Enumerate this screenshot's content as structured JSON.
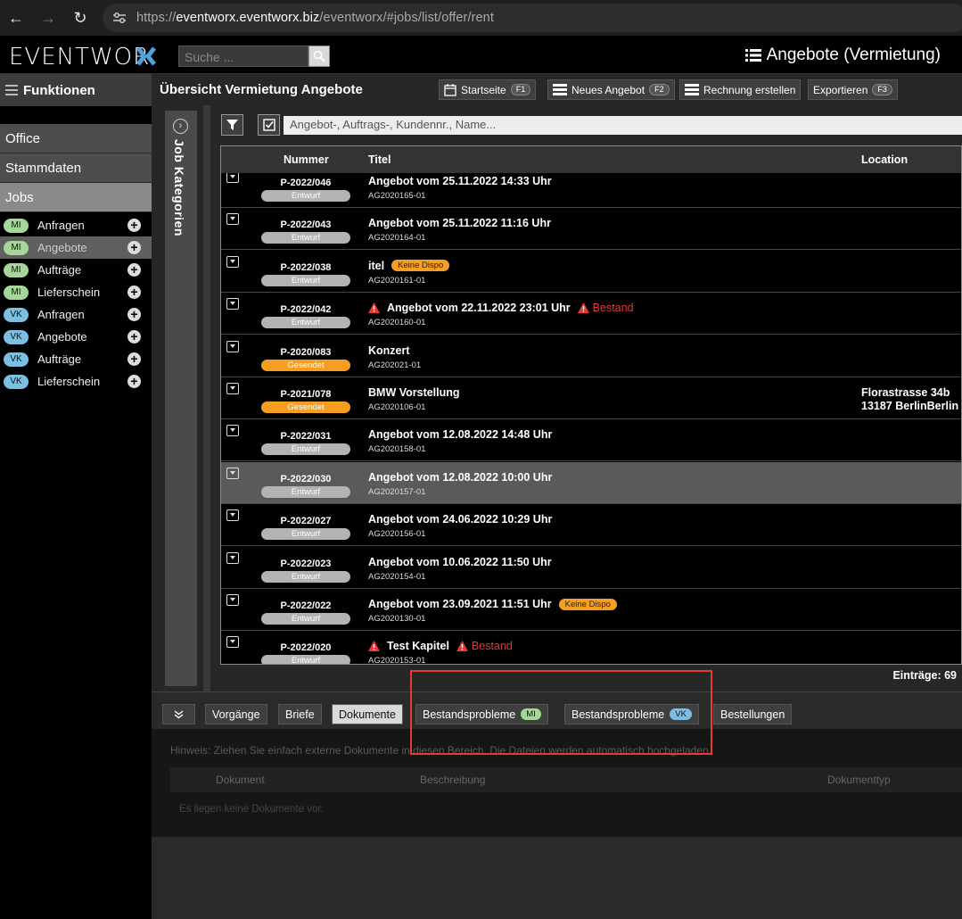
{
  "browser": {
    "url_prefix": "https://",
    "url_host": "eventworx.eventworx.biz",
    "url_path": "/eventworx/#jobs/list/offer/rent"
  },
  "app": {
    "logo": "EVENTWOR",
    "search_placeholder": "Suche ...",
    "page_title": "Angebote (Vermietung)"
  },
  "sidebar": {
    "functions_label": "Funktionen",
    "sections": [
      "Office",
      "Stammdaten",
      "Jobs"
    ],
    "items": [
      {
        "badge": "MI",
        "label": "Anfragen"
      },
      {
        "badge": "MI",
        "label": "Angebote"
      },
      {
        "badge": "MI",
        "label": "Aufträge"
      },
      {
        "badge": "MI",
        "label": "Lieferschein"
      },
      {
        "badge": "VK",
        "label": "Anfragen"
      },
      {
        "badge": "VK",
        "label": "Angebote"
      },
      {
        "badge": "VK",
        "label": "Aufträge"
      },
      {
        "badge": "VK",
        "label": "Lieferschein"
      }
    ]
  },
  "main": {
    "title": "Übersicht Vermietung Angebote",
    "toolbar": [
      {
        "label": "Startseite",
        "key": "F1"
      },
      {
        "label": "Neues Angebot",
        "key": "F2"
      },
      {
        "label": "Rechnung erstellen",
        "key": ""
      },
      {
        "label": "Exportieren",
        "key": "F3"
      }
    ],
    "side_panel_label": "Job Kategorien",
    "filter_placeholder": "Angebot-, Auftrags-, Kundennr., Name...",
    "columns": {
      "nummer": "Nummer",
      "titel": "Titel",
      "location": "Location"
    },
    "rows": [
      {
        "nr": "P-2022/046",
        "status": "Entwurf",
        "title": "Angebot vom 25.11.2022 14:33 Uhr",
        "sub": "AG2020165-01"
      },
      {
        "nr": "P-2022/043",
        "status": "Entwurf",
        "title": "Angebot vom 25.11.2022 11:16 Uhr",
        "sub": "AG2020164-01"
      },
      {
        "nr": "P-2022/038",
        "status": "Entwurf",
        "title": "itel",
        "sub": "AG2020161-01",
        "chip": "Keine Dispo"
      },
      {
        "nr": "P-2022/042",
        "status": "Entwurf",
        "title": "Angebot vom 22.11.2022 23:01 Uhr",
        "sub": "AG2020160-01",
        "warn_title": true,
        "warn": "Bestand"
      },
      {
        "nr": "P-2020/083",
        "status": "Gesendet",
        "title": "Konzert",
        "sub": "AG202021-01"
      },
      {
        "nr": "P-2021/078",
        "status": "Gesendet",
        "title": "BMW Vorstellung",
        "sub": "AG2020106-01",
        "location1": "Florastrasse 34b",
        "location2": "13187 BerlinBerlin /"
      },
      {
        "nr": "P-2022/031",
        "status": "Entwurf",
        "title": "Angebot vom 12.08.2022 14:48 Uhr",
        "sub": "AG2020158-01"
      },
      {
        "nr": "P-2022/030",
        "status": "Entwurf",
        "title": "Angebot vom 12.08.2022 10:00 Uhr",
        "sub": "AG2020157-01",
        "highlight": true
      },
      {
        "nr": "P-2022/027",
        "status": "Entwurf",
        "title": "Angebot vom 24.06.2022 10:29 Uhr",
        "sub": "AG2020156-01"
      },
      {
        "nr": "P-2022/023",
        "status": "Entwurf",
        "title": "Angebot vom 10.06.2022 11:50 Uhr",
        "sub": "AG2020154-01"
      },
      {
        "nr": "P-2022/022",
        "status": "Entwurf",
        "title": "Angebot vom 23.09.2021 11:51 Uhr",
        "sub": "AG2020130-01",
        "chip": "Keine Dispo"
      },
      {
        "nr": "P-2022/020",
        "status": "Entwurf",
        "title": "Test Kapitel",
        "sub": "AG2020153-01",
        "warn_title": true,
        "warn": "Bestand"
      }
    ],
    "entries": "Einträge: 69"
  },
  "bottom": {
    "tabs": [
      {
        "label": "Vorgänge"
      },
      {
        "label": "Briefe"
      },
      {
        "label": "Dokumente",
        "active": true
      },
      {
        "label": "Bestandsprobleme",
        "badge": "MI"
      },
      {
        "label": "Bestandsprobleme",
        "badge": "VK"
      },
      {
        "label": "Bestellungen"
      }
    ],
    "hint": "Hinweis: Ziehen Sie einfach externe Dokumente in diesen Bereich. Die Dateien werden automatisch hochgeladen.",
    "doc_columns": [
      "Dokument",
      "Beschreibung",
      "Dokumenttyp"
    ],
    "empty_text": "Es liegen keine Dokumente vor."
  },
  "colors": {
    "accent_blue": "#4aa3df",
    "mi_badge": "#a5d69a",
    "vk_badge": "#7bbfe3",
    "gesendet": "#f59e22",
    "warning": "#e53935"
  }
}
